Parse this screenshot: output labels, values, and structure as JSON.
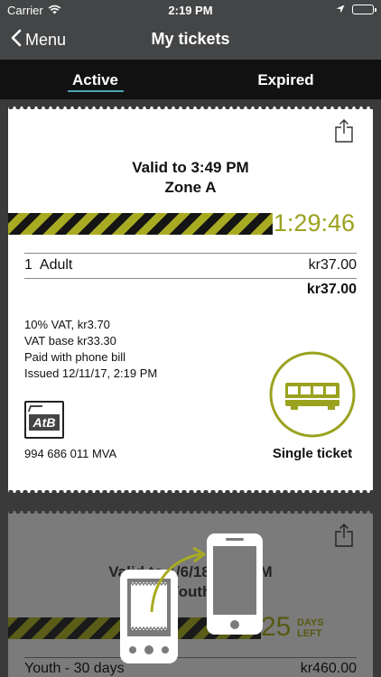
{
  "status_bar": {
    "carrier": "Carrier",
    "time": "2:19 PM"
  },
  "nav": {
    "back_label": "Menu",
    "title": "My tickets"
  },
  "tabs": [
    {
      "label": "Active",
      "selected": true
    },
    {
      "label": "Expired",
      "selected": false
    }
  ],
  "active_ticket": {
    "valid_to": "Valid to 3:49 PM",
    "zone": "Zone A",
    "countdown": "1:29:46",
    "line_item": {
      "label": "1  Adult",
      "price": "kr37.00"
    },
    "total": "kr37.00",
    "details": [
      "10% VAT, kr3.70",
      "VAT base kr33.30",
      "Paid with phone bill",
      "Issued 12/11/17, 2:19 PM"
    ],
    "logo_text": "AtB",
    "org_number": "994 686 011 MVA",
    "ticket_type": "Single ticket",
    "accent_color": "#a8ab21"
  },
  "second_ticket": {
    "valid_to": "Valid to 1/6/18 1:05 PM",
    "subtitle": "Youth",
    "days_number": "25",
    "days_label_1": "DAYS",
    "days_label_2": "LEFT",
    "line_item": {
      "label": "Youth - 30 days",
      "price": "kr460.00"
    }
  }
}
